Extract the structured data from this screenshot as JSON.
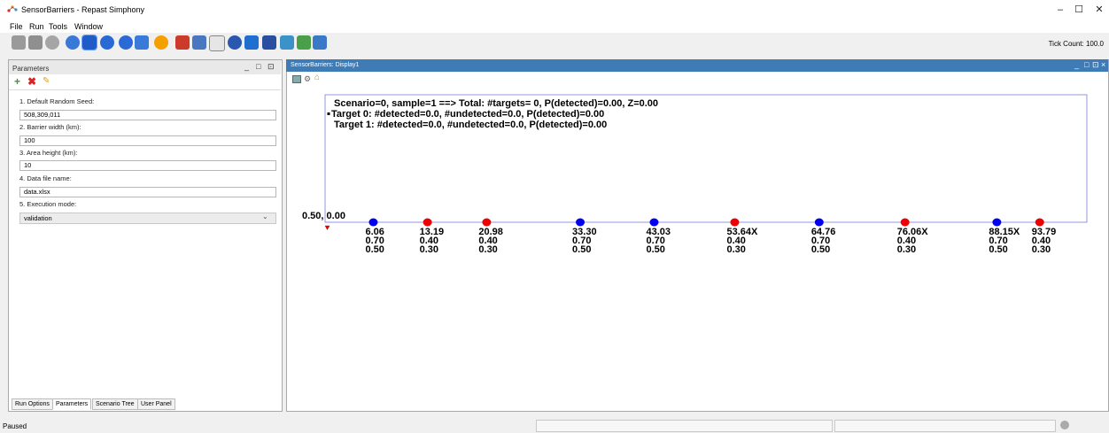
{
  "window": {
    "title": "SensorBarriers - Repast Simphony",
    "controls": [
      "–",
      "☐",
      "✕"
    ]
  },
  "menu": [
    "File",
    "Run",
    "Tools",
    "Window"
  ],
  "toolbar": {
    "icons": [
      "save-icon",
      "save-as-icon",
      "database-icon",
      "init-icon",
      "play-icon",
      "step-icon",
      "stop-icon",
      "reset-icon",
      "run-batch-icon",
      "spreadsheet-icon",
      "export-icon",
      "table-icon",
      "model-icon",
      "users-icon",
      "pipe-icon",
      "search-icon",
      "image-icon",
      "chart-icon"
    ],
    "tick_count": "Tick Count: 100.0"
  },
  "parameters_panel": {
    "title": "Parameters",
    "controls": [
      "_",
      "□",
      "⊡"
    ],
    "params": [
      {
        "label": "1. Default Random Seed:",
        "value": "508,309,011"
      },
      {
        "label": "2. Barrier width (km):",
        "value": "100"
      },
      {
        "label": "3. Area height (km):",
        "value": "10"
      },
      {
        "label": "4. Data file name:",
        "value": "data.xlsx"
      },
      {
        "label": "5. Execution mode:",
        "value": "validation"
      }
    ],
    "tabs": [
      "Run Options",
      "Parameters",
      "Scenario Tree",
      "User Panel"
    ]
  },
  "display": {
    "title": "SensorBarriers: Display1",
    "controls": [
      "_",
      "□",
      "⊡",
      "×"
    ],
    "summary_lines": [
      "Scenario=0, sample=1 ==> Total: #targets= 0, P(detected)=0.00, Z=0.00",
      "Target 0: #detected=0.0, #undetected=0.0, P(detected)=0.00",
      "Target 1: #detected=0.0, #undetected=0.0, P(detected)=0.00"
    ],
    "origin_label": "0.50, 0.00",
    "sensors": [
      {
        "pos": "6.06",
        "p": "0.70",
        "r": "0.50",
        "color": "#0000ee"
      },
      {
        "pos": "13.19",
        "p": "0.40",
        "r": "0.30",
        "color": "#ee0000"
      },
      {
        "pos": "20.98",
        "p": "0.40",
        "r": "0.30",
        "color": "#ee0000"
      },
      {
        "pos": "33.30",
        "p": "0.70",
        "r": "0.50",
        "color": "#0000ee"
      },
      {
        "pos": "43.03",
        "p": "0.70",
        "r": "0.50",
        "color": "#0000ee"
      },
      {
        "pos": "53.64X",
        "p": "0.40",
        "r": "0.30",
        "color": "#ee0000"
      },
      {
        "pos": "64.76",
        "p": "0.70",
        "r": "0.50",
        "color": "#0000ee"
      },
      {
        "pos": "76.06X",
        "p": "0.40",
        "r": "0.30",
        "color": "#ee0000"
      },
      {
        "pos": "88.15X",
        "p": "0.70",
        "r": "0.50",
        "color": "#0000ee"
      },
      {
        "pos": "93.79",
        "p": "0.40",
        "r": "0.30",
        "color": "#ee0000"
      }
    ]
  },
  "status": {
    "text": "Paused"
  }
}
